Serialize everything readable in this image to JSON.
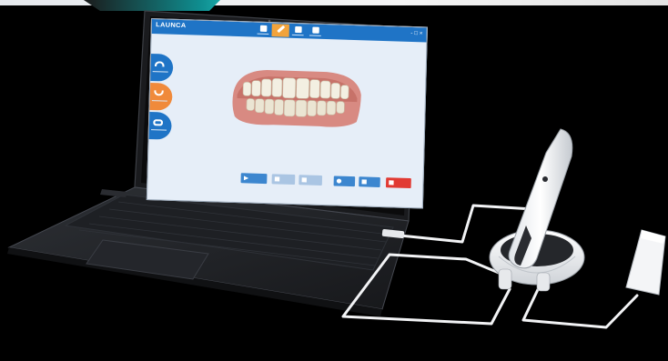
{
  "scene": {
    "colors": {
      "background": "#000000",
      "header_blue": "#1f74c6",
      "accent_orange": "#f08a3b",
      "danger_red": "#e13a33"
    }
  },
  "app": {
    "logo": "LAUNCA",
    "header_tabs": [
      {
        "icon": "scan-icon",
        "active": false
      },
      {
        "icon": "edit-icon",
        "active": true
      },
      {
        "icon": "model-icon",
        "active": false
      },
      {
        "icon": "export-icon",
        "active": false
      }
    ],
    "window_controls": "- □ ×",
    "side_buttons": [
      {
        "icon": "upper-jaw-icon"
      },
      {
        "icon": "lower-jaw-icon"
      },
      {
        "icon": "bite-icon"
      }
    ],
    "bottom_buttons": [
      {
        "icon": "play-icon",
        "state": "enabled"
      },
      {
        "icon": "pause-icon",
        "state": "disabled"
      },
      {
        "icon": "stop-icon",
        "state": "disabled"
      },
      {
        "icon": "reset-icon",
        "state": "enabled"
      },
      {
        "icon": "save-icon",
        "state": "enabled"
      },
      {
        "icon": "delete-icon",
        "state": "danger"
      }
    ]
  }
}
